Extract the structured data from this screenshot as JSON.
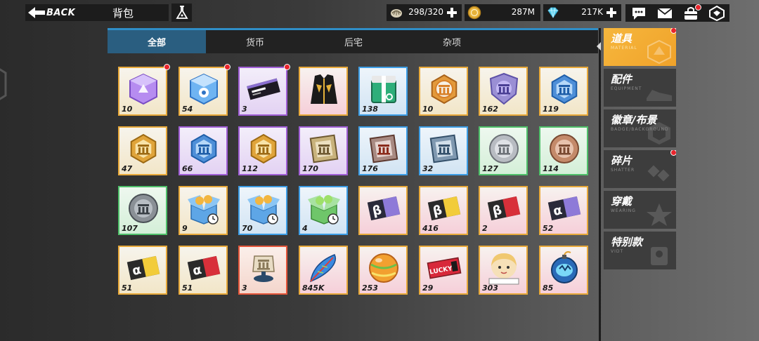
{
  "topbar": {
    "back_label": "BACK",
    "title": "背包",
    "resources": [
      {
        "name": "stamina",
        "icon": "fossil-icon",
        "value": "298/320",
        "has_plus": true
      },
      {
        "name": "coin",
        "icon": "coin-icon",
        "value": "287M",
        "has_plus": false
      },
      {
        "name": "diamond",
        "icon": "diamond-icon",
        "value": "217K",
        "has_plus": true
      }
    ],
    "icons": [
      "chat-icon",
      "mail-icon",
      "gift-bag-icon",
      "settings-icon"
    ]
  },
  "tabs": [
    {
      "label": "全部",
      "active": true
    },
    {
      "label": "货币",
      "active": false
    },
    {
      "label": "后宅",
      "active": false
    },
    {
      "label": "杂项",
      "active": false
    }
  ],
  "items": [
    {
      "count": "10",
      "rarity": "gold",
      "icon": "purple-cube-icon",
      "badge": true
    },
    {
      "count": "54",
      "rarity": "gold",
      "icon": "blue-cube-icon",
      "badge": true
    },
    {
      "count": "3",
      "rarity": "purple",
      "icon": "black-ticket-icon",
      "badge": true
    },
    {
      "count": "",
      "rarity": "pink",
      "icon": "black-coat-icon",
      "badge": false
    },
    {
      "count": "138",
      "rarity": "blue",
      "icon": "green-box-icon",
      "badge": false
    },
    {
      "count": "10",
      "rarity": "gold",
      "icon": "gold-medal-icon",
      "badge": false
    },
    {
      "count": "162",
      "rarity": "gold",
      "icon": "purple-shield-icon",
      "badge": false
    },
    {
      "count": "119",
      "rarity": "gold",
      "icon": "blue-hexagon-icon",
      "badge": false
    },
    {
      "count": "47",
      "rarity": "gold",
      "icon": "gold-hexagon-icon",
      "badge": false
    },
    {
      "count": "66",
      "rarity": "purple",
      "icon": "blue-hexagon-icon",
      "badge": false
    },
    {
      "count": "112",
      "rarity": "purple",
      "icon": "gold-hexagon-icon",
      "badge": false
    },
    {
      "count": "170",
      "rarity": "purple",
      "icon": "gold-square-icon",
      "badge": false
    },
    {
      "count": "176",
      "rarity": "blue",
      "icon": "red-square-icon",
      "badge": false
    },
    {
      "count": "32",
      "rarity": "blue",
      "icon": "blue-square-icon",
      "badge": false
    },
    {
      "count": "127",
      "rarity": "green",
      "icon": "silver-coin-icon",
      "badge": false
    },
    {
      "count": "114",
      "rarity": "green",
      "icon": "bronze-coin-icon",
      "badge": false
    },
    {
      "count": "107",
      "rarity": "green",
      "icon": "gray-coin-icon",
      "badge": false
    },
    {
      "count": "9",
      "rarity": "gold",
      "icon": "time-box-gold-icon",
      "badge": false
    },
    {
      "count": "70",
      "rarity": "blue",
      "icon": "time-box-gold-icon",
      "badge": false
    },
    {
      "count": "4",
      "rarity": "blue",
      "icon": "time-box-green-icon",
      "badge": false
    },
    {
      "count": "",
      "rarity": "pink",
      "icon": "beta-ticket-purple-icon",
      "badge": false
    },
    {
      "count": "416",
      "rarity": "pink",
      "icon": "beta-ticket-yellow-icon",
      "badge": false
    },
    {
      "count": "2",
      "rarity": "pink",
      "icon": "beta-ticket-red-icon",
      "badge": false
    },
    {
      "count": "52",
      "rarity": "pink",
      "icon": "alpha-ticket-purple-icon",
      "badge": false
    },
    {
      "count": "51",
      "rarity": "gold",
      "icon": "alpha-ticket-yellow-icon",
      "badge": false
    },
    {
      "count": "51",
      "rarity": "gold",
      "icon": "alpha-ticket-red-icon",
      "badge": false
    },
    {
      "count": "3",
      "rarity": "red",
      "icon": "figure-stand-icon",
      "badge": false
    },
    {
      "count": "845K",
      "rarity": "pink",
      "icon": "feather-icon",
      "badge": false
    },
    {
      "count": "253",
      "rarity": "pink",
      "icon": "orange-ball-icon",
      "badge": false
    },
    {
      "count": "29",
      "rarity": "pink",
      "icon": "lucky-ticket-icon",
      "badge": false
    },
    {
      "count": "303",
      "rarity": "pink",
      "icon": "girl-portrait-icon",
      "badge": false
    },
    {
      "count": "85",
      "rarity": "pink",
      "icon": "blue-bomb-icon",
      "badge": false
    }
  ],
  "categories": [
    {
      "label": "道具",
      "sub": "MATERIAL",
      "active": true,
      "badge": true,
      "icon": "material-icon"
    },
    {
      "label": "配件",
      "sub": "EQUIPMENT",
      "active": false,
      "badge": false,
      "icon": "shoe-icon"
    },
    {
      "label": "徽章/布景",
      "sub": "BADGE/BACKGROUND",
      "active": false,
      "badge": false,
      "icon": "badge-icon"
    },
    {
      "label": "碎片",
      "sub": "SHATTER",
      "active": false,
      "badge": true,
      "icon": "puzzle-icon"
    },
    {
      "label": "穿戴",
      "sub": "WEARING",
      "active": false,
      "badge": false,
      "icon": "star-icon"
    },
    {
      "label": "特别款",
      "sub": "VIDT",
      "active": false,
      "badge": false,
      "icon": "special-icon"
    }
  ],
  "colors": {
    "tab_accent": "#2f8ec7",
    "active_category": "#f0a22a",
    "gold_border": "#e8a93a",
    "purple_border": "#a15fd6",
    "blue_border": "#3d9ee6",
    "green_border": "#4fc06a",
    "red_border": "#e5563a",
    "badge_red": "#e8242c"
  }
}
